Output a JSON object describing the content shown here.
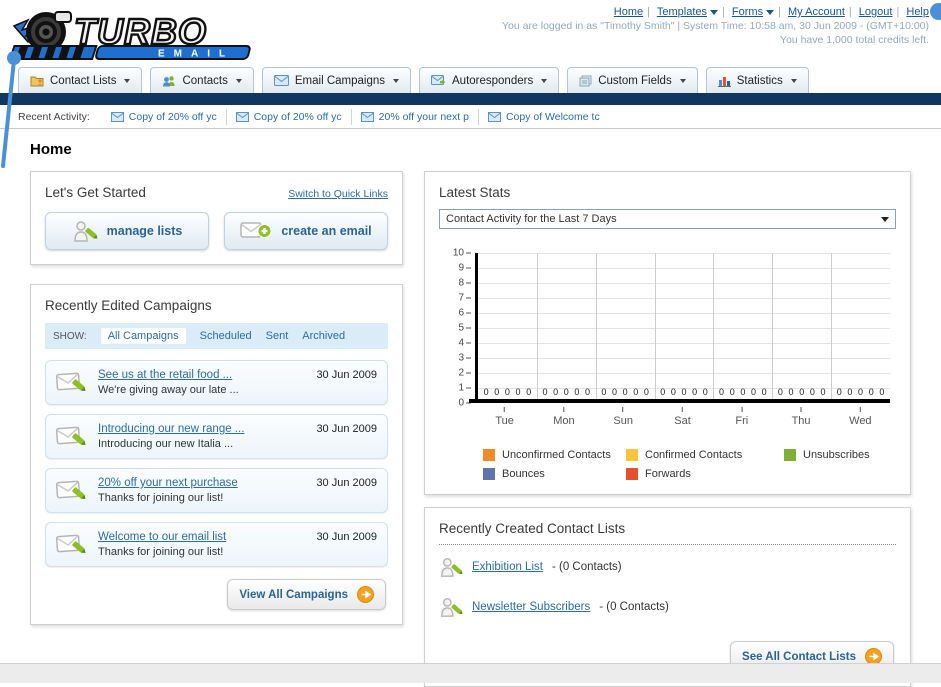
{
  "header": {
    "logo_line1": "TURBO",
    "logo_line2": "EMAIL",
    "nav_links": [
      {
        "label": "Home",
        "dropdown": false
      },
      {
        "label": "Templates",
        "dropdown": true
      },
      {
        "label": "Forms",
        "dropdown": true
      },
      {
        "label": "My Account",
        "dropdown": false
      },
      {
        "label": "Logout",
        "dropdown": false
      },
      {
        "label": "Help",
        "dropdown": false
      }
    ],
    "login_info": "You are logged in as \"Timothy Smith\" | System Time: 10:58 am, 30 Jun 2009 - (GMT+10:00)",
    "credits_info": "You have 1,000 total credits left."
  },
  "tabs": [
    {
      "label": "Contact Lists"
    },
    {
      "label": "Contacts"
    },
    {
      "label": "Email Campaigns"
    },
    {
      "label": "Autoresponders"
    },
    {
      "label": "Custom Fields"
    },
    {
      "label": "Statistics"
    }
  ],
  "recent_activity": {
    "label": "Recent Activity:",
    "items": [
      {
        "text": "Copy of 20% off yc"
      },
      {
        "text": "Copy of 20% off yc"
      },
      {
        "text": "20% off your next p"
      },
      {
        "text": "Copy of Welcome tc"
      }
    ]
  },
  "page_title": "Home",
  "get_started": {
    "title": "Let's Get Started",
    "switch_link": "Switch to Quick Links",
    "manage_lists_label": "manage lists",
    "create_email_label": "create an email"
  },
  "campaigns_panel": {
    "title": "Recently Edited Campaigns",
    "show_label": "SHOW:",
    "filters": [
      {
        "label": "All Campaigns",
        "active": true
      },
      {
        "label": "Scheduled",
        "active": false
      },
      {
        "label": "Sent",
        "active": false
      },
      {
        "label": "Archived",
        "active": false
      }
    ],
    "items": [
      {
        "title": "See us at the retail food ...",
        "subtitle": "We're giving away our late ...",
        "date": "30 Jun 2009"
      },
      {
        "title": "Introducing our new range ...",
        "subtitle": "Introducing our new Italia ...",
        "date": "30 Jun 2009"
      },
      {
        "title": "20% off your next purchase",
        "subtitle": "Thanks for joining our list!",
        "date": "30 Jun 2009"
      },
      {
        "title": "Welcome to our email list",
        "subtitle": "Thanks for joining our list!",
        "date": "30 Jun 2009"
      }
    ],
    "view_all_label": "View All Campaigns"
  },
  "stats_panel": {
    "title": "Latest Stats",
    "dropdown_value": "Contact Activity for the Last 7 Days"
  },
  "chart_data": {
    "type": "bar",
    "title": "Contact Activity for the Last 7 Days",
    "categories": [
      "Tue",
      "Mon",
      "Sun",
      "Sat",
      "Fri",
      "Thu",
      "Wed"
    ],
    "series": [
      {
        "name": "Unconfirmed Contacts",
        "color": "#F08C27",
        "values": [
          0,
          0,
          0,
          0,
          0,
          0,
          0
        ]
      },
      {
        "name": "Confirmed Contacts",
        "color": "#F6C53A",
        "values": [
          0,
          0,
          0,
          0,
          0,
          0,
          0
        ]
      },
      {
        "name": "Unsubscribes",
        "color": "#7CB22F",
        "values": [
          0,
          0,
          0,
          0,
          0,
          0,
          0
        ]
      },
      {
        "name": "Bounces",
        "color": "#5A76AC",
        "values": [
          0,
          0,
          0,
          0,
          0,
          0,
          0
        ]
      },
      {
        "name": "Forwards",
        "color": "#E8502B",
        "values": [
          0,
          0,
          0,
          0,
          0,
          0,
          0
        ]
      }
    ],
    "ylim": [
      0,
      10
    ],
    "yticks": [
      0,
      1,
      2,
      3,
      4,
      5,
      6,
      7,
      8,
      9,
      10
    ],
    "grid": true,
    "legend_position": "bottom",
    "value_labels_shown": true
  },
  "contact_lists_panel": {
    "title": "Recently Created Contact Lists",
    "items": [
      {
        "name": "Exhibition List",
        "detail": "- (0 Contacts)"
      },
      {
        "name": "Newsletter Subscribers",
        "detail": "- (0 Contacts)"
      }
    ],
    "see_all_label": "See All Contact Lists"
  },
  "icons": {
    "dropdown_caret": "▼",
    "arrow_circle": "➜"
  },
  "colors": {
    "navy_bar": "#10375F",
    "link_blue": "#2B6CA3",
    "button_text_blue": "#2A6496",
    "accent_orange": "#F5A11D",
    "brand_blue": "#1F6FD0"
  }
}
